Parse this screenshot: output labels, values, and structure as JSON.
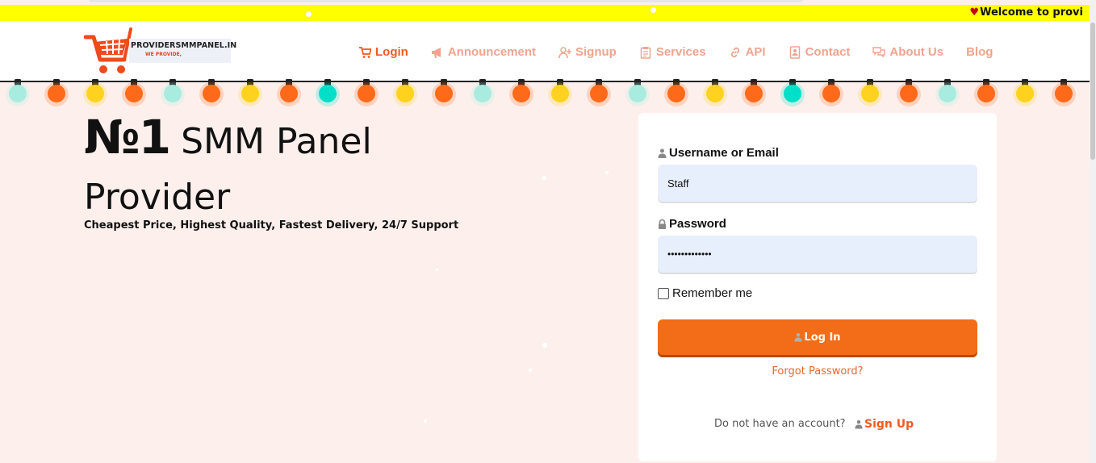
{
  "ticker": {
    "text": "Welcome to provi"
  },
  "brand": {
    "name": "PROVIDERSMMPANEL.IN",
    "tagline": "WE PROVIDE,"
  },
  "nav": [
    {
      "label": "Login",
      "icon": "cart-icon",
      "active": true
    },
    {
      "label": "Announcement",
      "icon": "megaphone-icon",
      "active": false
    },
    {
      "label": "Signup",
      "icon": "user-plus-icon",
      "active": false
    },
    {
      "label": "Services",
      "icon": "clipboard-icon",
      "active": false
    },
    {
      "label": "API",
      "icon": "link-icon",
      "active": false
    },
    {
      "label": "Contact",
      "icon": "address-book-icon",
      "active": false
    },
    {
      "label": "About Us",
      "icon": "chat-icon",
      "active": false
    },
    {
      "label": "Blog",
      "icon": "",
      "active": false
    }
  ],
  "hero": {
    "no1": "№1",
    "title_rest": " SMM Panel Provider",
    "subtitle": "Cheapest Price, Highest Quality, Fastest Delivery, 24/7 Support"
  },
  "login_form": {
    "username_label": "Username or Email",
    "username_value": "Staff",
    "password_label": "Password",
    "password_value": "•••••••••••••",
    "remember_label": "Remember me",
    "remember_checked": false,
    "submit_label": "Log In",
    "forgot_label": "Forgot Password?",
    "no_account_text": "Do not have an account?",
    "signup_label": "Sign Up"
  },
  "colors": {
    "accent": "#f15a22",
    "nav_inactive": "#f0a48f",
    "ticker_bg": "#ffff00",
    "page_bg": "#fdf0ec",
    "input_bg": "#e8effc",
    "button": "#f36c17"
  },
  "lights": [
    "#a8ecdf",
    "#ff6a1a",
    "#ffd21f",
    "#ff6a1a",
    "#a8ecdf",
    "#ff6a1a",
    "#ffd21f",
    "#ff6a1a",
    "#00e0c8",
    "#ff6a1a",
    "#ffd21f",
    "#ff6a1a",
    "#a8ecdf",
    "#ff6a1a",
    "#ffd21f",
    "#ff6a1a",
    "#a8ecdf",
    "#ff6a1a",
    "#ffd21f",
    "#ff6a1a",
    "#00e0c8",
    "#ff6a1a",
    "#ffd21f",
    "#ff6a1a",
    "#a8ecdf",
    "#ff6a1a",
    "#ffd21f",
    "#ff6a1a"
  ]
}
